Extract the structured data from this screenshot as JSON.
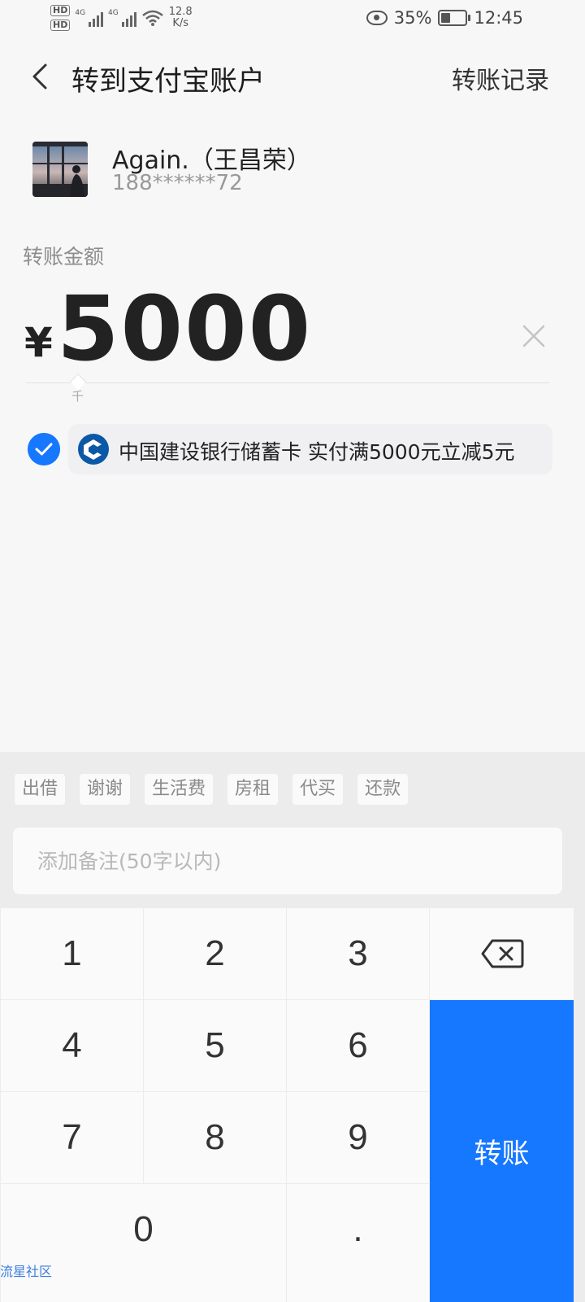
{
  "status_bar": {
    "hd1": "HD",
    "hd2": "HD",
    "signal1": "4G",
    "signal2": "4G",
    "net_speed_value": "12.8",
    "net_speed_unit": "K/s",
    "battery": "35%",
    "time": "12:45"
  },
  "header": {
    "title": "转到支付宝账户",
    "history_label": "转账记录"
  },
  "recipient": {
    "name": "Again.（王昌荣）",
    "phone": "188******72"
  },
  "amount": {
    "label": "转账金额",
    "currency": "¥",
    "value": "5000",
    "unit_hint": "千"
  },
  "payment": {
    "text": "中国建设银行储蓄卡 实付满5000元立减5元",
    "selected": true
  },
  "memo": {
    "chips": [
      "出借",
      "谢谢",
      "生活费",
      "房租",
      "代买",
      "还款"
    ],
    "placeholder": "添加备注(50字以内)",
    "value": ""
  },
  "keypad": {
    "digits": [
      "1",
      "2",
      "3",
      "4",
      "5",
      "6",
      "7",
      "8",
      "9",
      "0",
      "."
    ],
    "transfer_label": "转账"
  },
  "watermark": "流星社区",
  "colors": {
    "accent": "#1677ff",
    "background": "#f7f7f8",
    "panel": "#ececec"
  }
}
